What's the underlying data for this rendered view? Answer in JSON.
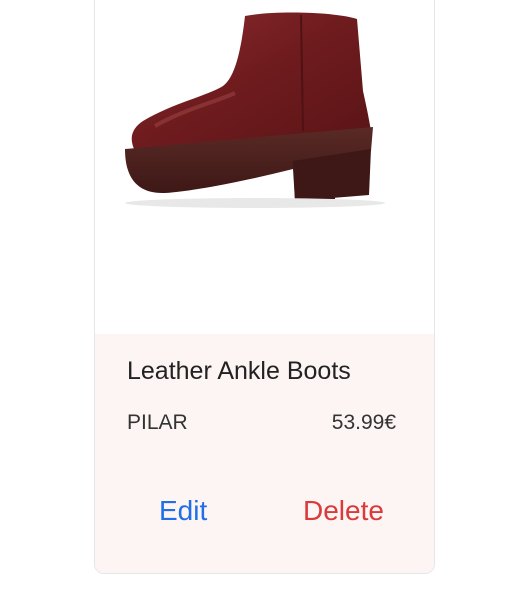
{
  "product": {
    "image_icon": "boot-image",
    "name": "Leather Ankle Boots",
    "brand": "PILAR",
    "price": "53.99€"
  },
  "actions": {
    "edit_label": "Edit",
    "delete_label": "Delete"
  },
  "colors": {
    "details_background": "#fdf4f4",
    "edit": "#1f6fe8",
    "delete": "#d93a3a",
    "boot_leather": "#7a1f22",
    "boot_sole": "#4a1d1a"
  }
}
